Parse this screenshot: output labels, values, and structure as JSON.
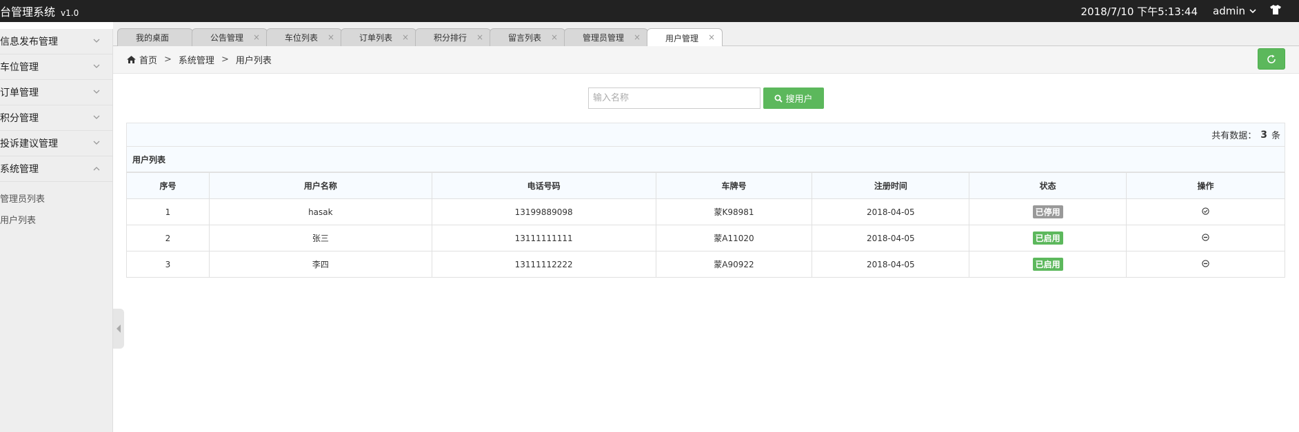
{
  "header": {
    "brand": "台管理系统",
    "version": "v1.0",
    "datetime": "2018/7/10 下午5:13:44",
    "user": "admin"
  },
  "sidebar": {
    "items": [
      {
        "label": "信息发布管理"
      },
      {
        "label": "车位管理"
      },
      {
        "label": "订单管理"
      },
      {
        "label": "积分管理"
      },
      {
        "label": "投诉建议管理"
      },
      {
        "label": "系统管理"
      }
    ],
    "subitems": [
      {
        "label": "管理员列表"
      },
      {
        "label": "用户列表"
      }
    ]
  },
  "tabs": [
    {
      "label": "我的桌面"
    },
    {
      "label": "公告管理"
    },
    {
      "label": "车位列表"
    },
    {
      "label": "订单列表"
    },
    {
      "label": "积分排行"
    },
    {
      "label": "留言列表"
    },
    {
      "label": "管理员管理"
    },
    {
      "label": "用户管理"
    }
  ],
  "tab_close": "×",
  "breadcrumb": {
    "home": "首页",
    "sep": ">",
    "level1": "系统管理",
    "level2": "用户列表"
  },
  "search": {
    "placeholder": "输入名称",
    "button": "搜用户"
  },
  "count": {
    "prefix": "共有数据：",
    "value": "3",
    "unit": "条"
  },
  "table": {
    "title": "用户列表",
    "headers": [
      "序号",
      "用户名称",
      "电话号码",
      "车牌号",
      "注册时间",
      "状态",
      "操作"
    ],
    "rows": [
      {
        "no": "1",
        "name": "hasak",
        "phone": "13199889098",
        "plate": "蒙K98981",
        "date": "2018-04-05",
        "status": "已停用"
      },
      {
        "no": "2",
        "name": "张三",
        "phone": "13111111111",
        "plate": "蒙A11020",
        "date": "2018-04-05",
        "status": "已启用"
      },
      {
        "no": "3",
        "name": "李四",
        "phone": "13111112222",
        "plate": "蒙A90922",
        "date": "2018-04-05",
        "status": "已启用"
      }
    ]
  },
  "colors": {
    "topbar": "#222222",
    "success": "#5cb85c",
    "disabled_badge": "#999999"
  }
}
